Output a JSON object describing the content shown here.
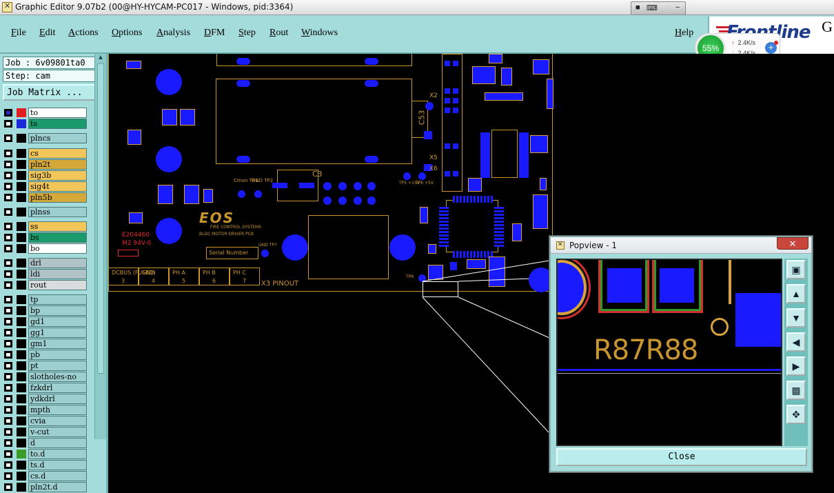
{
  "window": {
    "title": "Graphic Editor 9.07b2 (00@HY-HYCAM-PC017 - Windows, pid:3364)"
  },
  "menu": {
    "items": [
      "File",
      "Edit",
      "Actions",
      "Options",
      "Analysis",
      "DFM",
      "Step",
      "Rout",
      "Windows"
    ],
    "help": "Help"
  },
  "brand": {
    "logo": "Frontline",
    "suffix": "G"
  },
  "network_widget": {
    "percent": "55%",
    "upload": "2.4K/s",
    "download": "2.4K/s"
  },
  "job": {
    "label": "Job : 6v09801ta0",
    "step": "Step: cam",
    "matrix_button": "Job Matrix ..."
  },
  "layers": [
    {
      "name": "to",
      "color": "#ffffff",
      "swatch": "#e02020",
      "checked": true
    },
    {
      "name": "ts",
      "color": "#1a9a6a",
      "swatch": "#1a2ad8",
      "checked": false
    },
    {
      "name": "plncs",
      "color": "#9ecfd0",
      "swatch": "#000000",
      "checked": false
    },
    {
      "name": "cs",
      "color": "#f3c65a",
      "swatch": "#000000",
      "checked": false
    },
    {
      "name": "pln2t",
      "color": "#d4a93a",
      "swatch": "#000000",
      "checked": false
    },
    {
      "name": "sig3b",
      "color": "#f3c65a",
      "swatch": "#000000",
      "checked": false
    },
    {
      "name": "sig4t",
      "color": "#f3c65a",
      "swatch": "#000000",
      "checked": false
    },
    {
      "name": "pln5b",
      "color": "#d4a93a",
      "swatch": "#000000",
      "checked": false
    },
    {
      "name": "plnss",
      "color": "#9ecfd0",
      "swatch": "#000000",
      "checked": false
    },
    {
      "name": "ss",
      "color": "#f3c65a",
      "swatch": "#000000",
      "checked": false
    },
    {
      "name": "bs",
      "color": "#1a9a6a",
      "swatch": "#000000",
      "checked": false
    },
    {
      "name": "bo",
      "color": "#ffffff",
      "swatch": "#000000",
      "checked": false
    },
    {
      "name": "drl",
      "color": "#b0c4c8",
      "swatch": "#000000",
      "checked": false
    },
    {
      "name": "ldi",
      "color": "#b0c4c8",
      "swatch": "#000000",
      "checked": false
    },
    {
      "name": "rout",
      "color": "#d8dcdc",
      "swatch": "#000000",
      "checked": false
    },
    {
      "name": "tp",
      "color": "#9ecfd0",
      "swatch": "#000000",
      "checked": false
    },
    {
      "name": "bp",
      "color": "#9ecfd0",
      "swatch": "#000000",
      "checked": false
    },
    {
      "name": "gd1",
      "color": "#9ecfd0",
      "swatch": "#000000",
      "checked": false
    },
    {
      "name": "gg1",
      "color": "#9ecfd0",
      "swatch": "#000000",
      "checked": false
    },
    {
      "name": "gm1",
      "color": "#9ecfd0",
      "swatch": "#000000",
      "checked": false
    },
    {
      "name": "pb",
      "color": "#9ecfd0",
      "swatch": "#000000",
      "checked": false
    },
    {
      "name": "pt",
      "color": "#9ecfd0",
      "swatch": "#000000",
      "checked": false
    },
    {
      "name": "slotholes-no",
      "color": "#9ecfd0",
      "swatch": "#000000",
      "checked": false
    },
    {
      "name": "fzkdrl",
      "color": "#9ecfd0",
      "swatch": "#000000",
      "checked": false
    },
    {
      "name": "ydkdrl",
      "color": "#9ecfd0",
      "swatch": "#000000",
      "checked": false
    },
    {
      "name": "mpth",
      "color": "#9ecfd0",
      "swatch": "#000000",
      "checked": false
    },
    {
      "name": "cvia",
      "color": "#9ecfd0",
      "swatch": "#000000",
      "checked": false
    },
    {
      "name": "v-cut",
      "color": "#9ecfd0",
      "swatch": "#000000",
      "checked": false
    },
    {
      "name": "d",
      "color": "#9ecfd0",
      "swatch": "#000000",
      "checked": false
    },
    {
      "name": "to.d",
      "color": "#9ecfd0",
      "swatch": "#3a9a2a",
      "checked": false
    },
    {
      "name": "ts.d",
      "color": "#9ecfd0",
      "swatch": "#000000",
      "checked": false
    },
    {
      "name": "cs.d",
      "color": "#9ecfd0",
      "swatch": "#000000",
      "checked": false
    },
    {
      "name": "pln2t.d",
      "color": "#9ecfd0",
      "swatch": "#000000",
      "checked": false
    }
  ],
  "pcb": {
    "silk_labels": [
      "C53",
      "C3",
      "X2",
      "X5",
      "X6",
      "Serial Number",
      "X3 PINOUT",
      "FIRE CONTROL SYSTEMS",
      "BLDC MOTOR DRIVER PCB",
      "EOS",
      "R87 R88"
    ],
    "red_labels": [
      "E204460",
      "M2 94V-0"
    ],
    "pinout": [
      {
        "name": "DCBUS (FUSED)",
        "num": "3"
      },
      {
        "name": "GND",
        "num": "4"
      },
      {
        "name": "PH A",
        "num": "5"
      },
      {
        "name": "PH B",
        "num": "6"
      },
      {
        "name": "PH C",
        "num": "7"
      }
    ],
    "testpoints": [
      "Cmon TP1",
      "GND TP2",
      "TP5 +15V",
      "TP6 +5V",
      "GND TP7",
      "TP8"
    ]
  },
  "popview": {
    "title": "Popview - 1",
    "label": "R87R88",
    "close": "Close",
    "tools": [
      "zoom-window",
      "pan-up",
      "pan-down",
      "pan-left",
      "pan-right",
      "zoom-fit",
      "zoom-home"
    ]
  }
}
